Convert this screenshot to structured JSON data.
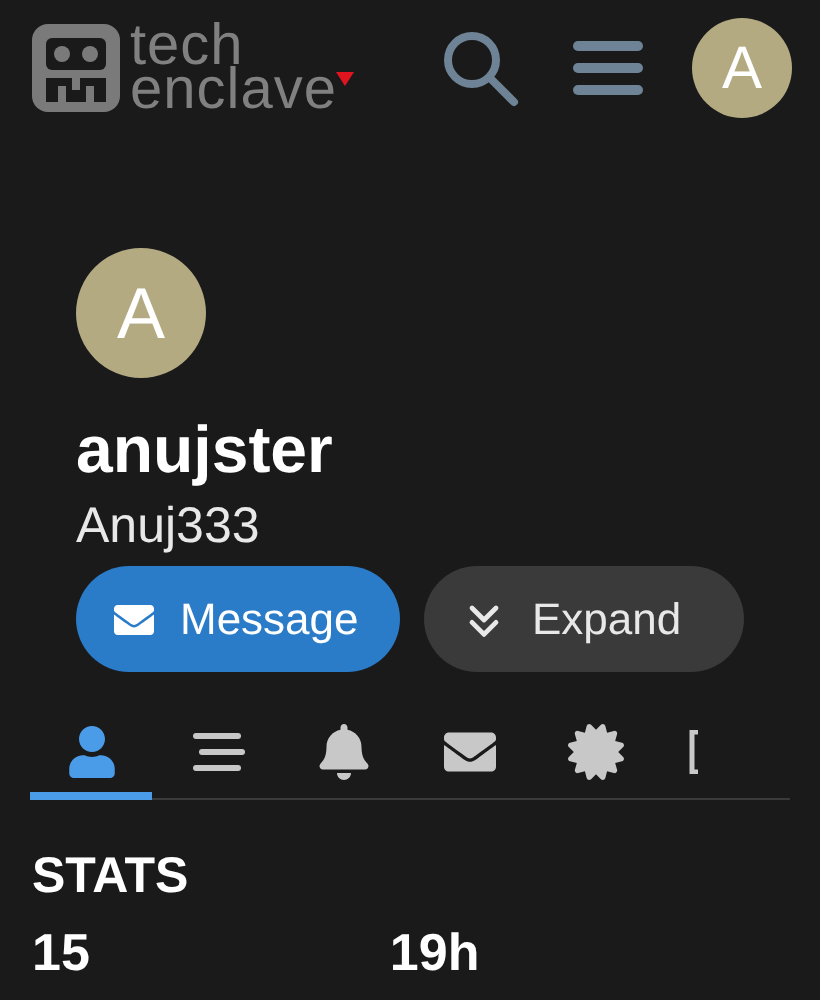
{
  "header": {
    "logo_lines": [
      "tech",
      "enclave"
    ],
    "avatar_letter": "A"
  },
  "profile": {
    "avatar_letter": "A",
    "username": "anujster",
    "title": "Anuj333"
  },
  "actions": [
    {
      "kind": "message",
      "label": "Message"
    },
    {
      "kind": "expand",
      "label": "Expand"
    }
  ],
  "tabs": [
    {
      "kind": "profile",
      "selected": true
    },
    {
      "kind": "posts",
      "selected": false
    },
    {
      "kind": "alerts",
      "selected": false
    },
    {
      "kind": "messages",
      "selected": false
    },
    {
      "kind": "badges",
      "selected": false
    },
    {
      "kind": "more",
      "selected": false
    }
  ],
  "stats": {
    "heading": "STATS",
    "values": [
      "15",
      "19h"
    ]
  }
}
